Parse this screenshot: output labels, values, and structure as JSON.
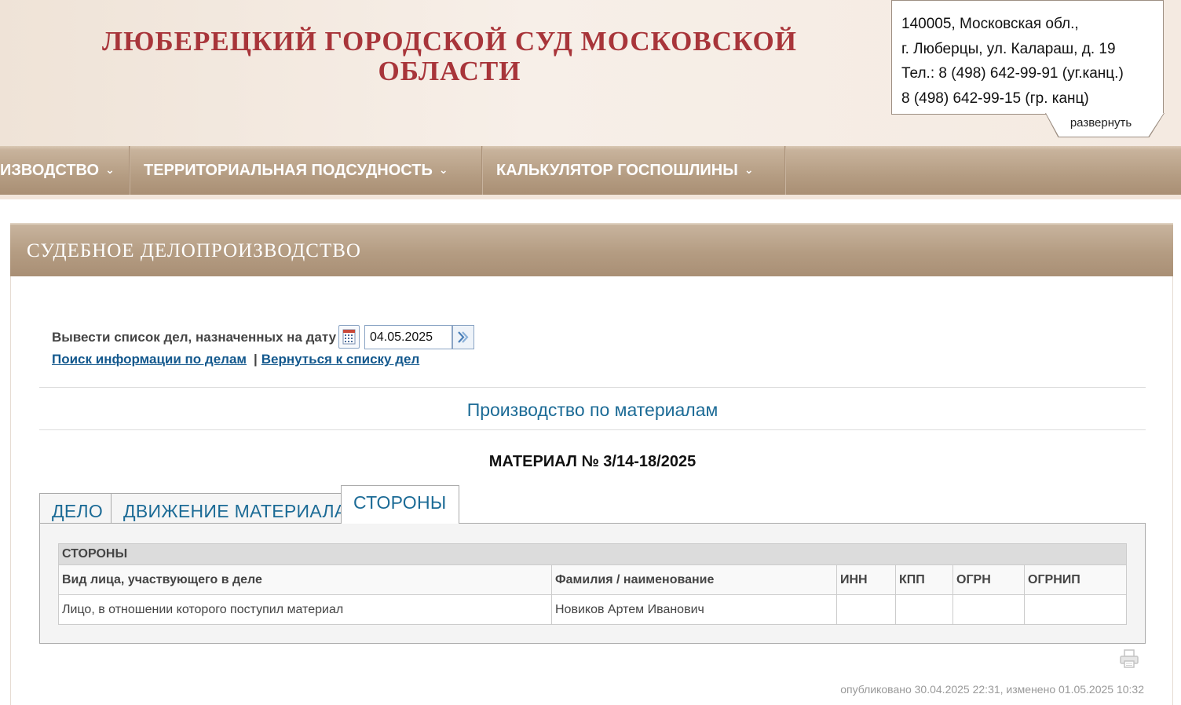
{
  "header": {
    "court_title_line1": "ЛЮБЕРЕЦКИЙ ГОРОДСКОЙ СУД МОСКОВСКОЙ",
    "court_title_line2": "ОБЛАСТИ",
    "contact": {
      "line1": "140005, Московская обл.,",
      "line2": "г. Люберцы, ул. Калараш, д. 19",
      "line3": "Тел.: 8 (498) 642-99-91 (уг.канц.)",
      "line4": "8 (498) 642-99-15 (гр. канц)"
    },
    "expand_label": "развернуть"
  },
  "nav": {
    "items": [
      {
        "label": "ИЗВОДСТВО"
      },
      {
        "label": "ТЕРРИТОРИАЛЬНАЯ ПОДСУДНОСТЬ"
      },
      {
        "label": "КАЛЬКУЛЯТОР ГОСПОШЛИНЫ"
      }
    ],
    "chevron": "⌄"
  },
  "card": {
    "title": "СУДЕБНОЕ ДЕЛОПРОИЗВОДСТВО",
    "date_label": "Вывести список дел, назначенных на дату",
    "date_value": "04.05.2025",
    "link_search": "Поиск информации по делам",
    "link_sep": "|",
    "link_back": "Вернуться к списку дел",
    "section_title": "Производство по материалам",
    "material_title": "МАТЕРИАЛ № 3/14-18/2025",
    "tabs": [
      {
        "label": "ДЕЛО"
      },
      {
        "label": "ДВИЖЕНИЕ МАТЕРИАЛА"
      },
      {
        "label": "СТОРОНЫ"
      }
    ],
    "active_tab": "СТОРОНЫ",
    "table": {
      "caption": "СТОРОНЫ",
      "headers": [
        "Вид лица, участвующего в деле",
        "Фамилия / наименование",
        "ИНН",
        "КПП",
        "ОГРН",
        "ОГРНИП"
      ],
      "rows": [
        [
          "Лицо, в отношении которого поступил материал",
          "Новиков Артем Иванович",
          "",
          "",
          "",
          ""
        ]
      ]
    },
    "published": "опубликовано 30.04.2025 22:31, изменено 01.05.2025 10:32"
  },
  "colors": {
    "title_red": "#a8353a",
    "link_blue": "#13588d",
    "nav_brown": "#b59d83"
  }
}
